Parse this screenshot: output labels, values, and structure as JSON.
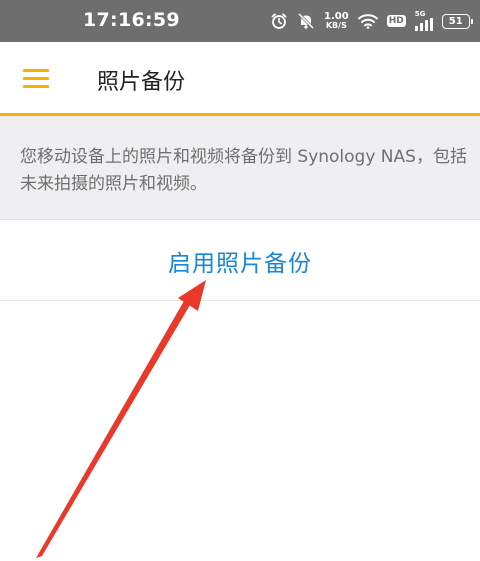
{
  "status_bar": {
    "time": "17:16:59",
    "net_speed_value": "1.00",
    "net_speed_unit": "KB/S",
    "hd_label": "HD",
    "signal_label": "5G",
    "battery": "51",
    "icons": [
      "alarm-icon",
      "mute-icon",
      "wifi-icon",
      "hd-icon",
      "signal-icon",
      "battery-icon"
    ]
  },
  "app_bar": {
    "menu_icon": "hamburger-menu-icon",
    "title": "照片备份",
    "accent_color": "#f2b400"
  },
  "description": {
    "text": "您移动设备上的照片和视频将备份到 Synology NAS，包括未来拍摄的照片和视频。"
  },
  "action": {
    "enable_label": "启用照片备份",
    "color": "#1a86d6"
  },
  "annotation": {
    "arrow_color": "#e8392a"
  }
}
